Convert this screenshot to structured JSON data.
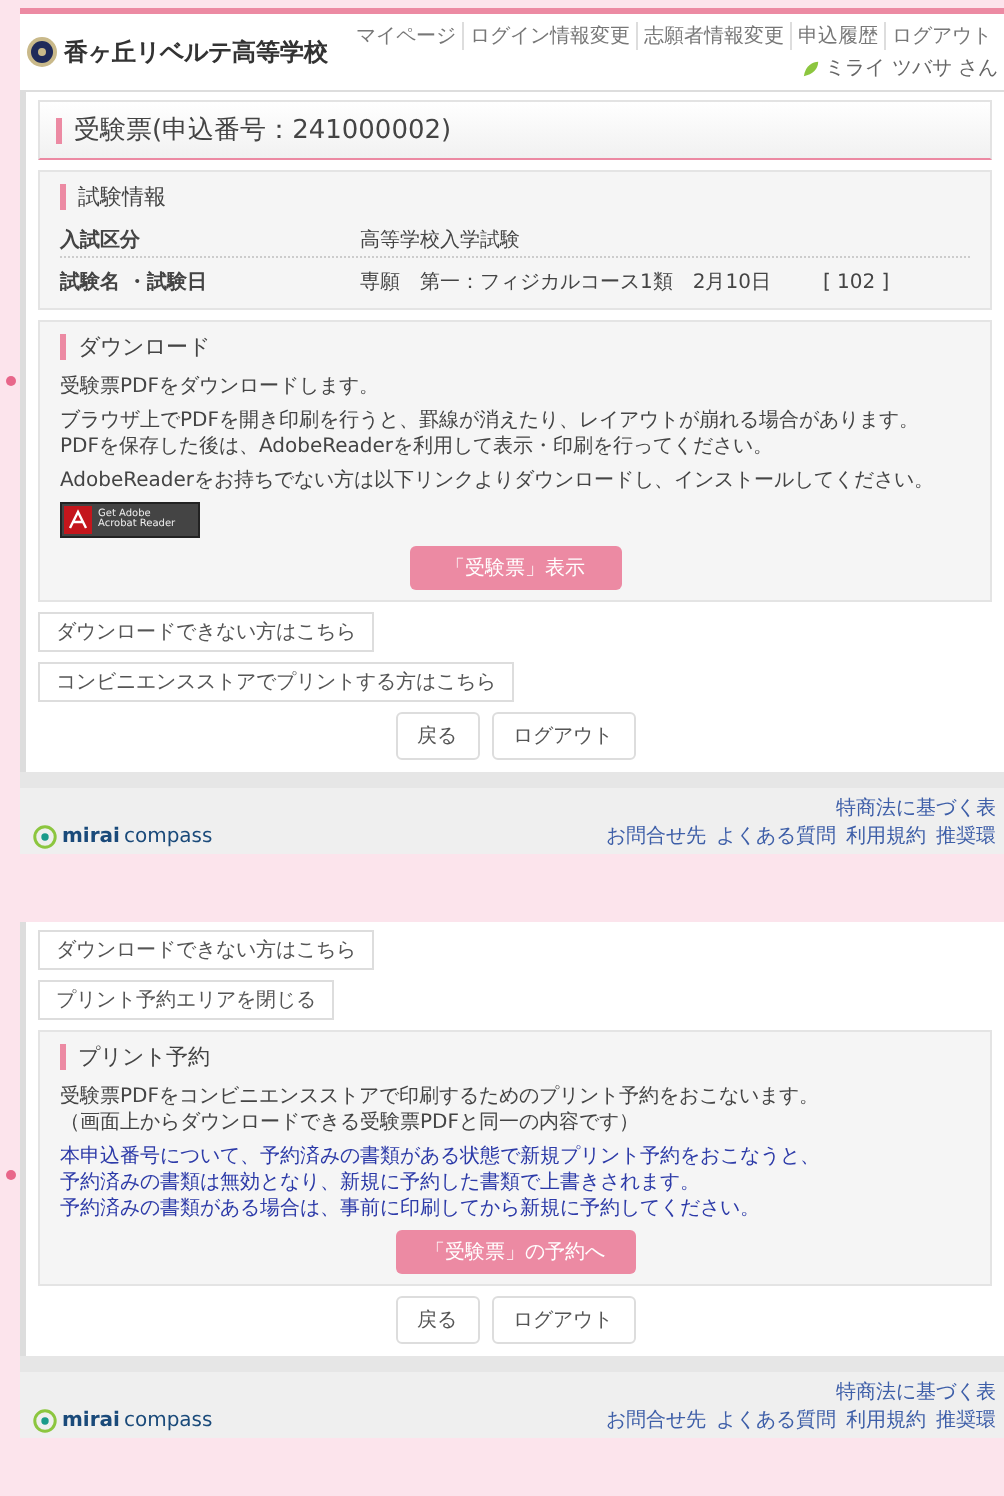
{
  "upper_screen": {
    "header": {
      "school_name": "香ヶ丘リベルテ高等学校",
      "nav": [
        "マイページ",
        "ログイン情報変更",
        "志願者情報変更",
        "申込履歴",
        "ログアウト"
      ],
      "user": "ミライ ツバサ さん"
    },
    "page_title": "受験票(申込番号：241000002)",
    "exam_info": {
      "heading": "試験情報",
      "rows": [
        {
          "label": "入試区分",
          "value": "高等学校入学試験"
        },
        {
          "label": "試験名 ・試験日",
          "value": "専願　第一：フィジカルコース1類　2月10日",
          "extra": "[ 102 ]"
        }
      ]
    },
    "download": {
      "heading": "ダウンロード",
      "paragraphs": [
        {
          "lines": [
            "受験票PDFをダウンロードします。"
          ]
        },
        {
          "lines": [
            "ブラウザ上でPDFを開き印刷を行うと、罫線が消えたり、レイアウトが崩れる場合があります。",
            "PDFを保存した後は、AdobeReaderを利用して表示・印刷を行ってください。"
          ]
        },
        {
          "lines": [
            "AdobeReaderをお持ちでない方は以下リンクよりダウンロードし、インストールしてください。"
          ]
        }
      ],
      "adobe_badge": [
        "Get Adobe",
        "Acrobat Reader"
      ],
      "button": "「受験票」表示"
    },
    "links": [
      "ダウンロードできない方はこちら",
      "コンビニエンスストアでプリントする方はこちら"
    ],
    "buttons": [
      "戻る",
      "ログアウト"
    ],
    "footer": {
      "logo_bold": "mirai",
      "logo_rest": "compass",
      "top_link": "特商法に基づく表",
      "links": [
        "お問合せ先",
        "よくある質問",
        "利用規約",
        "推奨環"
      ]
    }
  },
  "lower_screen": {
    "links": [
      "ダウンロードできない方はこちら",
      "プリント予約エリアを閉じる"
    ],
    "print_reservation": {
      "heading": "プリント予約",
      "paragraphs": [
        {
          "kind": "normal",
          "lines": [
            "受験票PDFをコンビニエンスストアで印刷するためのプリント予約をおこないます。",
            "（画面上からダウンロードできる受験票PDFと同一の内容です）"
          ]
        },
        {
          "kind": "notice",
          "lines": [
            "本申込番号について、予約済みの書類がある状態で新規プリント予約をおこなうと、",
            "予約済みの書類は無効となり、新規に予約した書類で上書きされます。",
            "予約済みの書類がある場合は、事前に印刷してから新規に予約してください。"
          ]
        }
      ],
      "button": "「受験票」の予約へ"
    },
    "buttons": [
      "戻る",
      "ログアウト"
    ],
    "footer": {
      "logo_bold": "mirai",
      "logo_rest": "compass",
      "top_link": "特商法に基づく表",
      "links": [
        "お問合せ先",
        "よくある質問",
        "利用規約",
        "推奨環"
      ]
    }
  }
}
